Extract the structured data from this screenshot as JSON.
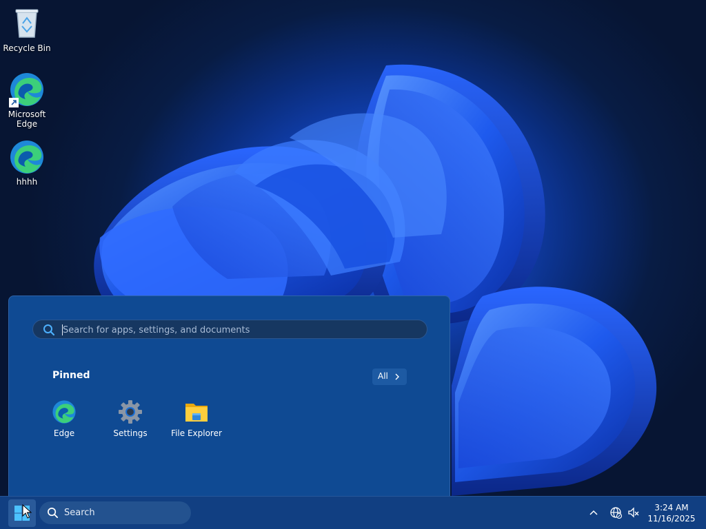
{
  "desktop": {
    "icons": [
      {
        "label": "Recycle Bin",
        "icon": "recycle-bin-icon"
      },
      {
        "label": "Microsoft Edge",
        "icon": "edge-icon"
      },
      {
        "label": "hhhh",
        "icon": "edge-icon"
      }
    ]
  },
  "start_menu": {
    "search": {
      "value": "",
      "placeholder": "Search for apps, settings, and documents"
    },
    "pinned_title": "Pinned",
    "all_label": "All",
    "pinned_apps": [
      {
        "label": "Edge",
        "icon": "edge-icon"
      },
      {
        "label": "Settings",
        "icon": "settings-gear-icon"
      },
      {
        "label": "File Explorer",
        "icon": "folder-icon"
      }
    ]
  },
  "taskbar": {
    "search_label": "Search",
    "time": "3:24 AM",
    "date": "11/16/2025"
  },
  "colors": {
    "start_menu_bg": "#0f4a93",
    "taskbar_bg": "#113f82",
    "accent": "#1d5aa3"
  }
}
